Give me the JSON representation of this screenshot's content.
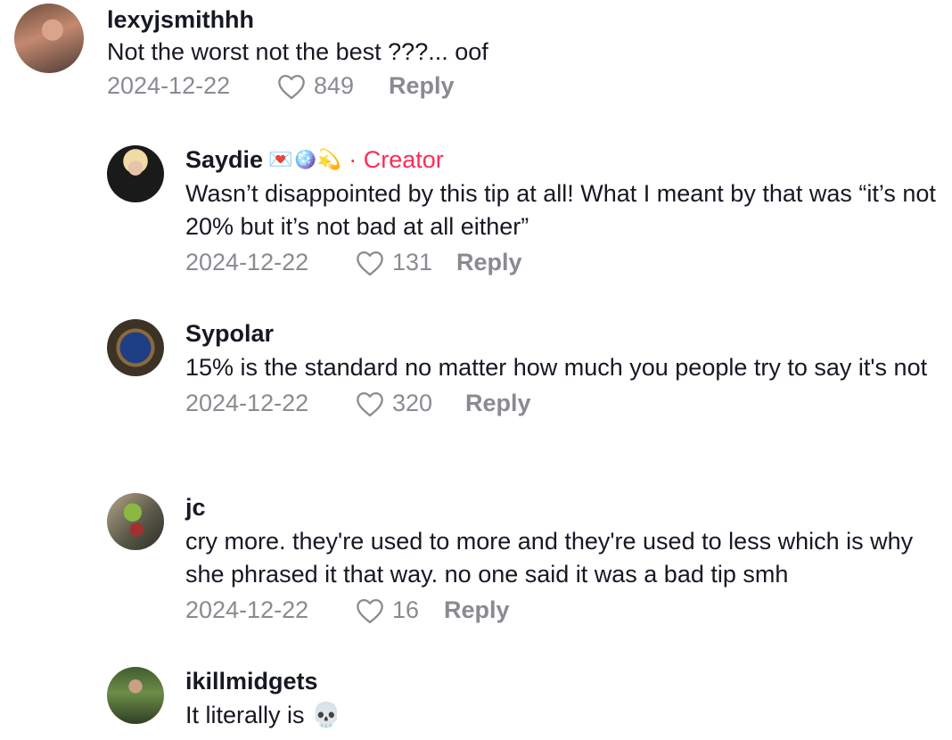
{
  "comments": [
    {
      "username": "lexyjsmithhh",
      "text": "Not the worst not the best ???... oof",
      "date": "2024-12-22",
      "likes": "849",
      "reply_label": "Reply"
    },
    {
      "username": "Saydie",
      "name_emoji": "💌🪩💫",
      "creator_label": "· Creator",
      "text": "Wasn’t disappointed by this tip at all! What I meant by that was “it’s not 20% but it’s not bad at all either”",
      "date": "2024-12-22",
      "likes": "131",
      "reply_label": "Reply"
    },
    {
      "username": "Sypolar",
      "text": "15% is the standard no matter how much you people try to say it's not",
      "date": "2024-12-22",
      "likes": "320",
      "reply_label": "Reply"
    },
    {
      "username": "jc",
      "text": "cry more. they're used to more and they're used to less which is why she phrased it that way. no one said it was a bad tip smh",
      "date": "2024-12-22",
      "likes": "16",
      "reply_label": "Reply"
    },
    {
      "username": "ikillmidgets",
      "text": "It literally is 💀"
    }
  ],
  "icons": {
    "like": "heart-outline-icon",
    "avatar": "profile-photo"
  },
  "colors": {
    "creator_accent": "#fe2c55",
    "meta_text": "#8a8b91",
    "primary_text": "#161823"
  }
}
